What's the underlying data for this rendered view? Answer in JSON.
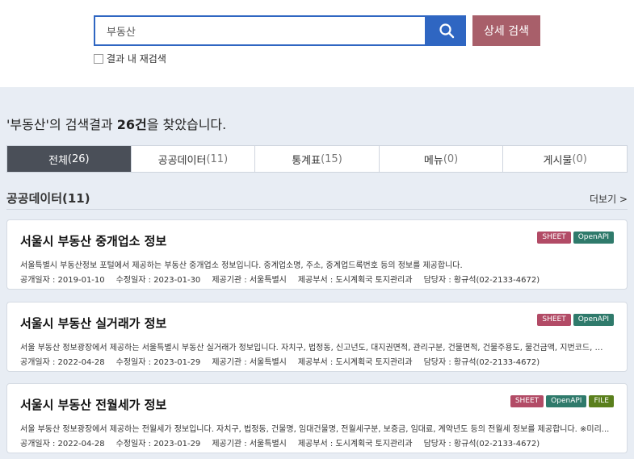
{
  "search": {
    "value": "부동산",
    "detail_label": "상세 검색",
    "research_label": "결과 내 재검색"
  },
  "result": {
    "prefix": "'부동산'의 검색결과 ",
    "count": "26건",
    "suffix": "을 찾았습니다."
  },
  "tabs": [
    {
      "label": "전체",
      "count": "(26)"
    },
    {
      "label": "공공데이터",
      "count": "(11)"
    },
    {
      "label": "통계표",
      "count": "(15)"
    },
    {
      "label": "메뉴",
      "count": "(0)"
    },
    {
      "label": "게시물",
      "count": "(0)"
    }
  ],
  "section": {
    "title": "공공데이터(11)",
    "more": "더보기 >"
  },
  "cards": [
    {
      "title": "서울시 부동산 중개업소 정보",
      "badges": [
        "SHEET",
        "OpenAPI"
      ],
      "desc": "서울특별시 부동산정보 포털에서 제공하는 부동산 중개업소 정보입니다. 중계업소명, 주소, 중계업드록번호 등의 정보를 제공합니다.",
      "open_date": "공개일자 : 2019-01-10",
      "mod_date": "수정일자 : 2023-01-30",
      "org": "제공기관 : 서울특별시",
      "dept": "제공부서 : 도시계획국 토지관리과",
      "contact": "담당자 : 황규석(02-2133-4672)"
    },
    {
      "title": "서울시 부동산 실거래가 정보",
      "badges": [
        "SHEET",
        "OpenAPI"
      ],
      "desc": "서울 부동산 정보광장에서 제공하는 서울특별시 부동산 실거래가 정보입니다. 자치구, 법정동, 신고년도, 대지권면적, 관리구분, 건물면적, 건물주용도, 물건금액, 지번코드, 건...",
      "open_date": "공개일자 : 2022-04-28",
      "mod_date": "수정일자 : 2023-01-29",
      "org": "제공기관 : 서울특별시",
      "dept": "제공부서 : 도시계획국 토지관리과",
      "contact": "담당자 : 황규석(02-2133-4672)"
    },
    {
      "title": "서울시 부동산 전월세가 정보",
      "badges": [
        "SHEET",
        "OpenAPI",
        "FILE"
      ],
      "desc": "서울 부동산 정보광장에서 제공하는 전월세가 정보입니다. 자치구, 법정동, 건물명, 임대건물명, 전월세구분, 보증금, 임대료, 계약년도 등의 전월세 정보를 제공합니다. ※미리...",
      "open_date": "공개일자 : 2022-04-28",
      "mod_date": "수정일자 : 2023-01-29",
      "org": "제공기관 : 서울특별시",
      "dept": "제공부서 : 도시계획국 토지관리과",
      "contact": "담당자 : 황규석(02-2133-4672)"
    }
  ],
  "colors": {
    "primary": "#2f66c2",
    "detail_button": "#a85f6a",
    "active_tab": "#4a4f58",
    "sheet": "#b24b66",
    "openapi": "#2f7a6b",
    "file": "#5a7f1c"
  },
  "icons": {
    "search": "search-icon"
  }
}
